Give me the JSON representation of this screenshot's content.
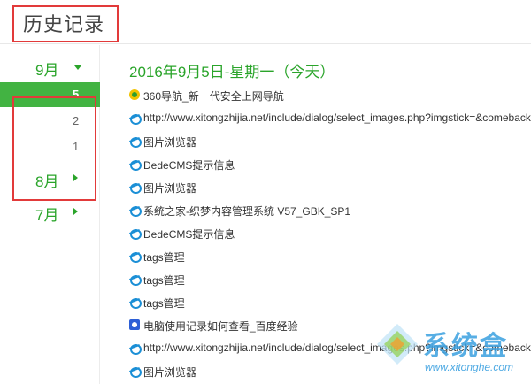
{
  "header": {
    "title": "历史记录"
  },
  "sidebar": {
    "months": [
      {
        "label": "9月",
        "expanded": true,
        "days": [
          "5",
          "2",
          "1"
        ],
        "selected_day": "5"
      },
      {
        "label": "8月",
        "expanded": false
      },
      {
        "label": "7月",
        "expanded": false
      }
    ]
  },
  "main": {
    "date_heading": "2016年9月5日-星期一（今天）",
    "entries": [
      {
        "icon": "nav-icon",
        "text": "360导航_新一代安全上网导航"
      },
      {
        "icon": "ie-icon",
        "text": "http://www.xitongzhijia.net/include/dialog/select_images.php?imgstick=&comeback"
      },
      {
        "icon": "ie-icon",
        "text": "图片浏览器"
      },
      {
        "icon": "ie-icon",
        "text": "DedeCMS提示信息"
      },
      {
        "icon": "ie-icon",
        "text": "图片浏览器"
      },
      {
        "icon": "ie-icon",
        "text": "系统之家-织梦内容管理系统 V57_GBK_SP1"
      },
      {
        "icon": "ie-icon",
        "text": "DedeCMS提示信息"
      },
      {
        "icon": "ie-icon",
        "text": "tags管理"
      },
      {
        "icon": "ie-icon",
        "text": "tags管理"
      },
      {
        "icon": "ie-icon",
        "text": "tags管理"
      },
      {
        "icon": "baidu-icon",
        "text": "电脑使用记录如何查看_百度经验"
      },
      {
        "icon": "ie-icon",
        "text": "http://www.xitongzhijia.net/include/dialog/select_images.php?imgstick=&comeback"
      },
      {
        "icon": "ie-icon",
        "text": "图片浏览器"
      }
    ]
  },
  "watermark": {
    "name": "系统盒",
    "url": "www.xitonghe.com"
  },
  "colors": {
    "accent_green": "#2aa42a",
    "selected_bg": "#42b342",
    "highlight_red": "#e23a3a",
    "link_blue": "#1b8fd6"
  }
}
